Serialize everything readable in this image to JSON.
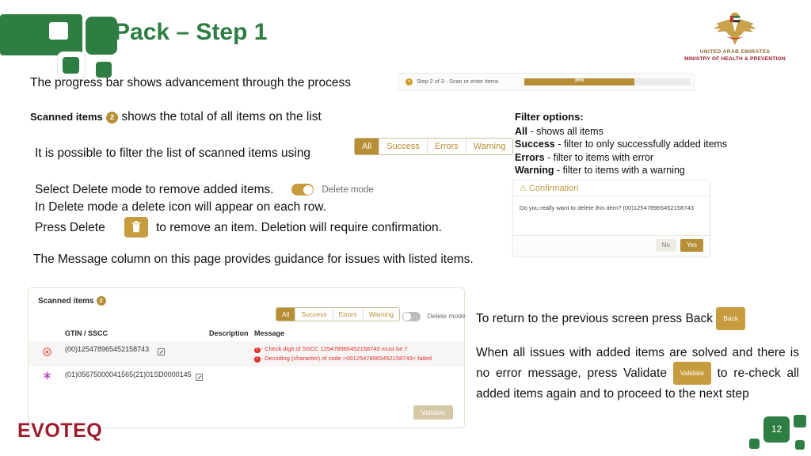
{
  "slide": {
    "title": "Pack – Step 1",
    "page_number": "12",
    "footer_brand": "EVOTEQ",
    "accent_gold": "#b58e35",
    "accent_green": "#2e7d42",
    "accent_red": "#e03131",
    "brand_maroon": "#9b1c2e"
  },
  "mohap_logo": {
    "line1": "UNITED ARAB EMIRATES",
    "line2": "MINISTRY OF HEALTH & PREVENTION"
  },
  "body": {
    "line_progress": "The progress bar shows advancement through the process",
    "scanned_items_label": "Scanned items",
    "scanned_items_count": "2",
    "line_scanned_rest": "shows the total of all items on the list",
    "line_filter": "It is possible to filter the list of scanned items using",
    "line_delete_1": "Select Delete mode to remove added items.",
    "delete_mode_label": "Delete mode",
    "line_delete_2": "In Delete mode a delete icon will appear on each row.",
    "line_delete_3a": "Press Delete",
    "line_delete_3b": "to remove an item. Deletion will require confirmation.",
    "line_message_col": "The Message column on this page provides guidance for issues with listed items."
  },
  "progress_widget": {
    "step_label": "Step 2 of 3 - Scan or enter items",
    "percent_label": "35%",
    "percent_value": 35
  },
  "filter_callout": {
    "buttons": [
      {
        "label": "All",
        "active": true
      },
      {
        "label": "Success",
        "active": false
      },
      {
        "label": "Errors",
        "active": false
      },
      {
        "label": "Warning",
        "active": false
      }
    ]
  },
  "filter_options": {
    "title": "Filter options:",
    "items": [
      {
        "name": "All",
        "desc": " - shows all items"
      },
      {
        "name": "Success",
        "desc": " - filter to only successfully added items"
      },
      {
        "name": "Errors",
        "desc": " - filter to items with error"
      },
      {
        "name": "Warning",
        "desc": " - filter to items with a warning"
      }
    ]
  },
  "confirmation_dialog": {
    "title": "Confirmation",
    "message": "Do you really want to delete this item? (00)125478965452158743",
    "no_label": "No",
    "yes_label": "Yes"
  },
  "app_panel": {
    "scanned_items_label": "Scanned items",
    "scanned_items_count": "2",
    "filter_buttons": [
      {
        "label": "All",
        "active": true
      },
      {
        "label": "Success",
        "active": false
      },
      {
        "label": "Errors",
        "active": false
      },
      {
        "label": "Warning",
        "active": false
      }
    ],
    "delete_mode_label": "Delete mode",
    "delete_mode_on": false,
    "columns": {
      "gtin": "GTIN / SSCC",
      "description": "Description",
      "message": "Message"
    },
    "rows": [
      {
        "status": "error",
        "code": "(00)125478965452158743",
        "description": "",
        "messages": [
          "- Check digit of SSCC 125478965452158743 must be 7",
          "- Decoding (character) of code >00125478965452158743< failed"
        ]
      },
      {
        "status": "new",
        "code": "(01)05675000041565(21)01SD0000145",
        "description": "",
        "messages": []
      }
    ],
    "validate_label": "Validate"
  },
  "right_column": {
    "back_text_before": "To return to the previous screen press Back",
    "back_button_label": "Back",
    "validate_text_before": "When all issues with added items are solved and there is no error message, press Validate",
    "validate_button_label": "Validate",
    "validate_text_after": "to re-check all added items again and to proceed to the next step"
  }
}
